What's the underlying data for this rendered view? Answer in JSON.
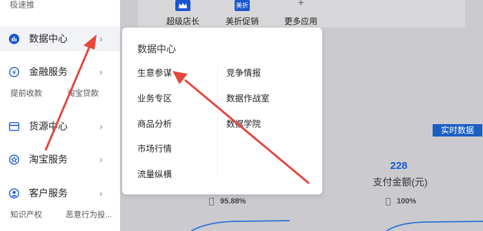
{
  "sidebar": {
    "top_text": "极速推",
    "items": [
      {
        "label": "数据中心"
      },
      {
        "label": "金融服务"
      },
      {
        "label": "货源中心"
      },
      {
        "label": "淘宝服务"
      },
      {
        "label": "客户服务"
      }
    ],
    "finance_subs": [
      "提前收款",
      "淘宝贷款"
    ],
    "customer_subs": [
      "知识产权",
      "恶意行为投..."
    ],
    "chevron": "›"
  },
  "apps": [
    {
      "label": "超级店长",
      "icon": "crown-icon"
    },
    {
      "label": "美折促销",
      "icon": "discount-icon",
      "icon_text": "美折"
    },
    {
      "label": "更多应用",
      "icon": "plus-icon",
      "icon_text": "+"
    }
  ],
  "popup": {
    "title": "数据中心",
    "left_links": [
      "生意参谋",
      "业务专区",
      "商品分析",
      "市场行情",
      "流量纵横"
    ],
    "right_links": [
      "竞争情报",
      "数据作战室",
      "数据学院"
    ]
  },
  "stats": {
    "realtime_button": "实时数据",
    "value": "228",
    "label": "支付金额(元)",
    "pct_left": "95.88%",
    "pct_right": "100%"
  },
  "colors": {
    "accent": "#1a57cf",
    "arrow": "#e8453c"
  }
}
